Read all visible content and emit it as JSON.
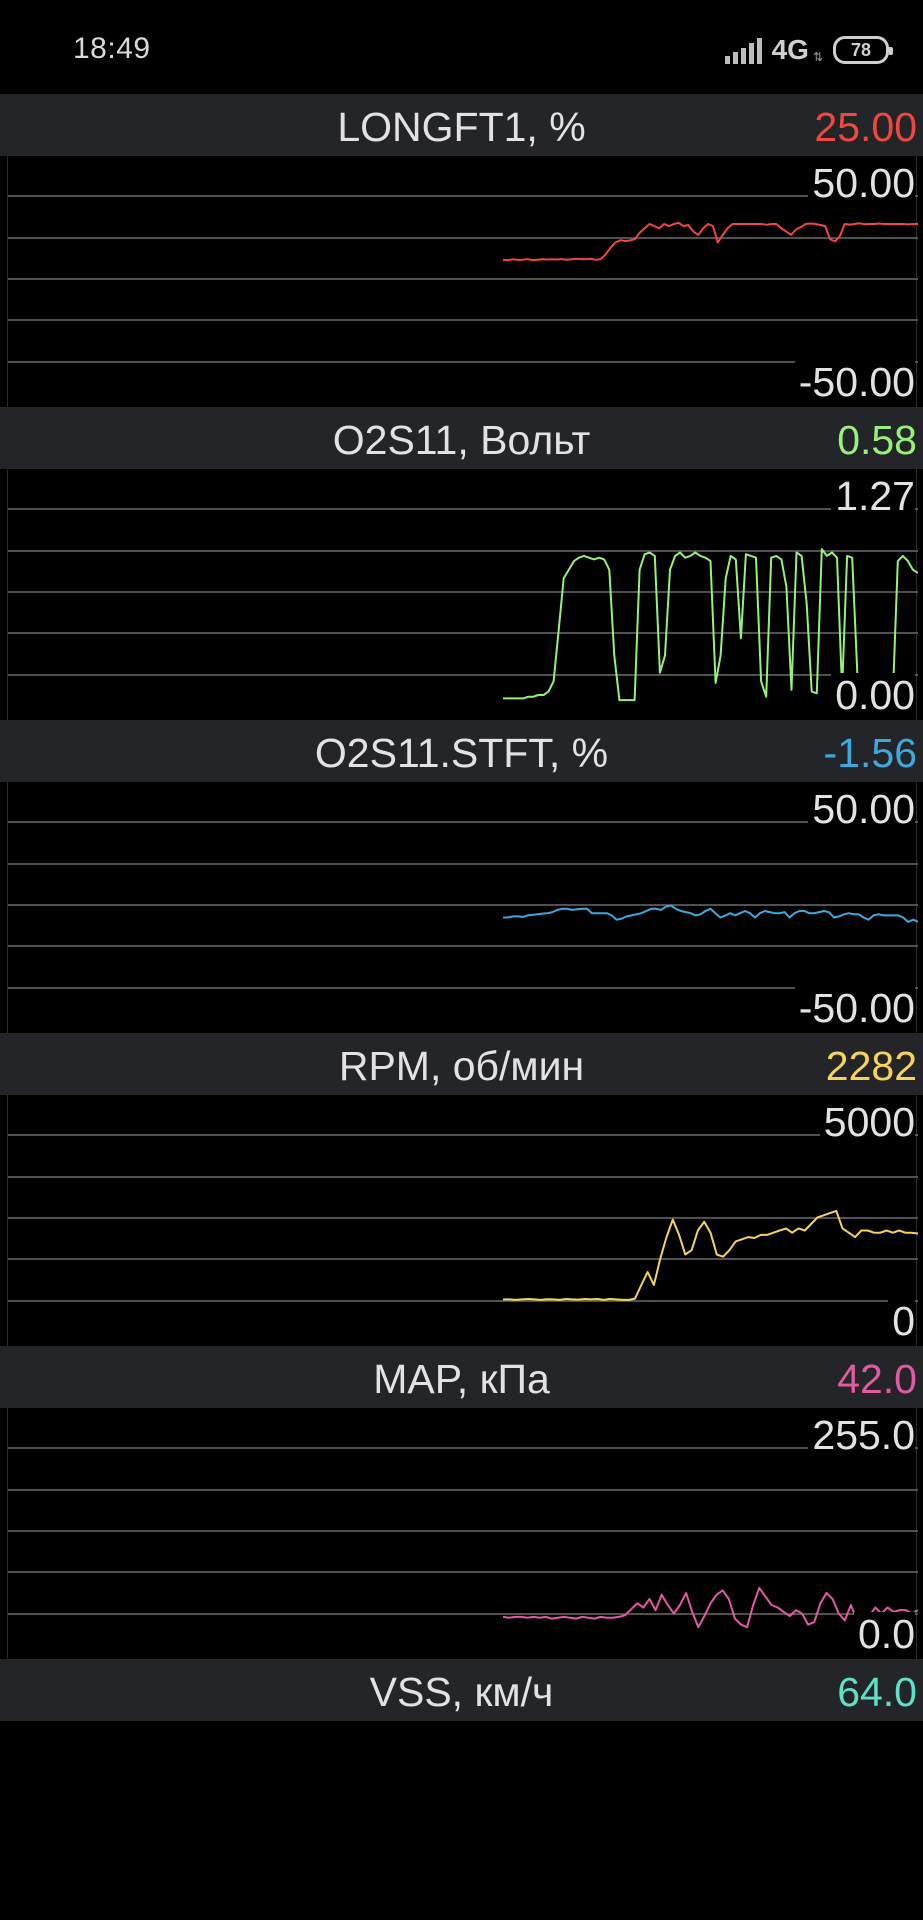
{
  "status_bar": {
    "time": "18:49",
    "network": "4G",
    "battery": "78",
    "icons": [
      "signal-icon",
      "battery-icon"
    ]
  },
  "panels": [
    {
      "name": "LONGFT1, %",
      "value": "25.00",
      "color": "#f0473f",
      "max_label": "50.00",
      "min_label": "-50.00",
      "chart_data": {
        "type": "line",
        "ylim": [
          -50,
          50
        ],
        "values": [
          11.5,
          11.4,
          11.8,
          11.5,
          11.6,
          11.9,
          11.4,
          11.6,
          11.8,
          11.7,
          11.8,
          11.7,
          11.9,
          11.6,
          11.8,
          12,
          11.9,
          11.8,
          12,
          11.6,
          11.8,
          14,
          17,
          19.5,
          20.5,
          20.2,
          20.4,
          21,
          24,
          26,
          28,
          27,
          26,
          28,
          27,
          28,
          28.5,
          27,
          27.5,
          24.5,
          23,
          26,
          28,
          27,
          19.5,
          23,
          26,
          28,
          28,
          28,
          28,
          28,
          28,
          28,
          27.6,
          28,
          28,
          26,
          24.5,
          23,
          25.5,
          26.5,
          28,
          28.2,
          28,
          27.5,
          27,
          21,
          20,
          22.5,
          28,
          27.7,
          28,
          28.3,
          27.9,
          28,
          28,
          28.2,
          28,
          28,
          28,
          28,
          28,
          27.8,
          28,
          28
        ]
      }
    },
    {
      "name": "O2S11, Вольт",
      "value": "0.58",
      "color": "#98f07a",
      "max_label": "1.27",
      "min_label": "0.00",
      "chart_data": {
        "type": "line",
        "ylim": [
          0,
          1.27
        ],
        "values": [
          0.05,
          0.05,
          0.05,
          0.05,
          0.05,
          0.06,
          0.06,
          0.07,
          0.07,
          0.09,
          0.15,
          0.45,
          0.75,
          0.8,
          0.85,
          0.87,
          0.88,
          0.87,
          0.86,
          0.87,
          0.86,
          0.8,
          0.3,
          0.04,
          0.04,
          0.04,
          0.04,
          0.8,
          0.89,
          0.9,
          0.88,
          0.2,
          0.3,
          0.8,
          0.88,
          0.9,
          0.87,
          0.88,
          0.9,
          0.88,
          0.87,
          0.85,
          0.14,
          0.3,
          0.75,
          0.88,
          0.86,
          0.4,
          0.89,
          0.88,
          0.87,
          0.15,
          0.06,
          0.87,
          0.88,
          0.86,
          0.7,
          0.1,
          0.9,
          0.88,
          0.6,
          0.09,
          0.08,
          0.92,
          0.88,
          0.9,
          0.87,
          0.1,
          0.88,
          0.87,
          0.2,
          0.04,
          0.04,
          0.04,
          0.04,
          0.04,
          0.04,
          0.04,
          0.85,
          0.88,
          0.85,
          0.8,
          0.78
        ]
      }
    },
    {
      "name": "O2S11.STFT, %",
      "value": "-1.56",
      "color": "#3ea9de",
      "max_label": "50.00",
      "min_label": "-50.00",
      "chart_data": {
        "type": "line",
        "ylim": [
          -50,
          50
        ],
        "values": [
          -3,
          -3,
          -2.5,
          -2.5,
          -2.7,
          -2,
          -1.8,
          -1.5,
          -1.2,
          -1,
          -0.5,
          0.5,
          1,
          1,
          0.5,
          0.8,
          1,
          1,
          -1,
          -1,
          -1,
          -1,
          -2,
          -4,
          -3.5,
          -2.5,
          -2,
          -1.5,
          -1,
          0,
          1,
          1,
          0.5,
          2,
          2.5,
          1,
          0,
          -0.5,
          -1,
          -2,
          -1.5,
          0,
          1,
          -1,
          -3,
          -2,
          -1,
          -2,
          -1,
          0,
          -1,
          -3,
          -1,
          0,
          -0.5,
          -1,
          -1,
          -0.5,
          -3,
          -1,
          0,
          0,
          -1,
          -1,
          -0.5,
          0,
          -0.6,
          -3,
          -2.5,
          -1.5,
          -1,
          -1.5,
          -1.5,
          -3,
          -4,
          -2,
          -1.5,
          -2,
          -2,
          -2,
          -2,
          -3,
          -5,
          -4,
          -5
        ]
      }
    },
    {
      "name": "RPM, об/мин",
      "value": "2282",
      "color": "#f7d35a",
      "max_label": "5000",
      "min_label": "0",
      "chart_data": {
        "type": "line",
        "ylim": [
          0,
          5000
        ],
        "values": [
          770,
          770,
          760,
          770,
          780,
          770,
          760,
          775,
          770,
          760,
          780,
          770,
          765,
          780,
          770,
          780,
          760,
          780,
          770,
          760,
          760,
          790,
          1100,
          1400,
          1100,
          1700,
          2200,
          2600,
          2250,
          1800,
          1900,
          2350,
          2550,
          2300,
          1800,
          1750,
          1900,
          2100,
          2150,
          2200,
          2180,
          2250,
          2250,
          2300,
          2350,
          2400,
          2300,
          2400,
          2350,
          2500,
          2650,
          2700,
          2750,
          2800,
          2400,
          2300,
          2200,
          2350,
          2350,
          2300,
          2300,
          2350,
          2300,
          2350,
          2300,
          2300,
          2282
        ]
      }
    },
    {
      "name": "MAP, кПа",
      "value": "42.0",
      "color": "#e15aa3",
      "max_label": "255.0",
      "min_label": "0.0",
      "chart_data": {
        "type": "line",
        "ylim": [
          0,
          255
        ],
        "values": [
          34,
          33,
          34,
          34,
          33,
          34,
          33,
          34,
          32,
          33,
          34,
          33,
          32,
          34,
          33,
          32,
          34,
          33,
          33,
          34,
          36,
          43,
          50,
          45,
          55,
          42,
          60,
          48,
          38,
          48,
          62,
          40,
          22,
          35,
          50,
          60,
          65,
          55,
          32,
          25,
          22,
          48,
          68,
          58,
          48,
          45,
          40,
          35,
          42,
          38,
          25,
          28,
          50,
          62,
          55,
          38,
          30,
          48,
          30,
          20,
          35,
          45,
          38,
          45,
          40,
          42,
          42,
          38,
          42
        ]
      }
    },
    {
      "name": "VSS, км/ч",
      "value": "64.0",
      "color": "#5ee2c6"
    }
  ]
}
